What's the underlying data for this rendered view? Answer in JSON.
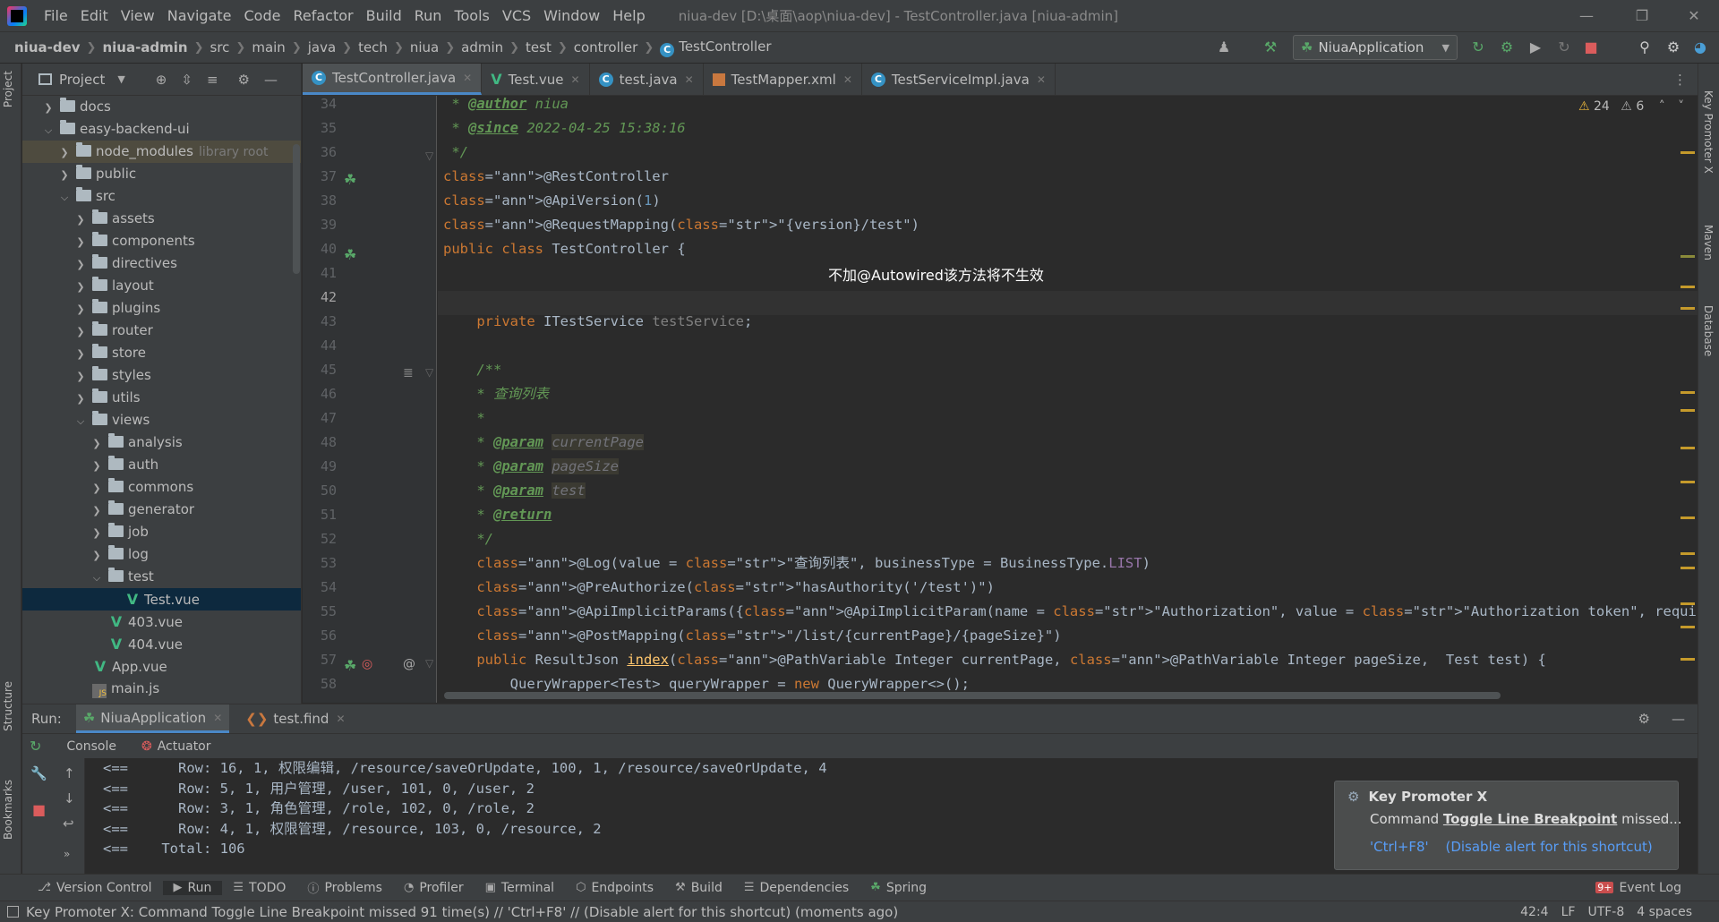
{
  "menu": [
    "File",
    "Edit",
    "View",
    "Navigate",
    "Code",
    "Refactor",
    "Build",
    "Run",
    "Tools",
    "VCS",
    "Window",
    "Help"
  ],
  "window_title": "niua-dev [D:\\桌面\\aop\\niua-dev] - TestController.java [niua-admin]",
  "breadcrumb": [
    "niua-dev",
    "niua-admin",
    "src",
    "main",
    "java",
    "tech",
    "niua",
    "admin",
    "test",
    "controller",
    "TestController"
  ],
  "run_config": "NiuaApplication",
  "project": {
    "title": "Project",
    "tree": [
      {
        "label": "docs",
        "kind": "folder",
        "depth": 1,
        "arrow": "right"
      },
      {
        "label": "easy-backend-ui",
        "kind": "folder",
        "depth": 1,
        "arrow": "down"
      },
      {
        "label": "node_modules",
        "suffix": "library root",
        "kind": "folder",
        "depth": 2,
        "arrow": "right",
        "highlight": true
      },
      {
        "label": "public",
        "kind": "folder",
        "depth": 2,
        "arrow": "right"
      },
      {
        "label": "src",
        "kind": "folder",
        "depth": 2,
        "arrow": "down"
      },
      {
        "label": "assets",
        "kind": "folder",
        "depth": 3,
        "arrow": "right"
      },
      {
        "label": "components",
        "kind": "folder",
        "depth": 3,
        "arrow": "right"
      },
      {
        "label": "directives",
        "kind": "folder",
        "depth": 3,
        "arrow": "right"
      },
      {
        "label": "layout",
        "kind": "folder",
        "depth": 3,
        "arrow": "right"
      },
      {
        "label": "plugins",
        "kind": "folder",
        "depth": 3,
        "arrow": "right"
      },
      {
        "label": "router",
        "kind": "folder",
        "depth": 3,
        "arrow": "right"
      },
      {
        "label": "store",
        "kind": "folder",
        "depth": 3,
        "arrow": "right"
      },
      {
        "label": "styles",
        "kind": "folder",
        "depth": 3,
        "arrow": "right"
      },
      {
        "label": "utils",
        "kind": "folder",
        "depth": 3,
        "arrow": "right"
      },
      {
        "label": "views",
        "kind": "folder",
        "depth": 3,
        "arrow": "down"
      },
      {
        "label": "analysis",
        "kind": "folder",
        "depth": 4,
        "arrow": "right"
      },
      {
        "label": "auth",
        "kind": "folder",
        "depth": 4,
        "arrow": "right"
      },
      {
        "label": "commons",
        "kind": "folder",
        "depth": 4,
        "arrow": "right"
      },
      {
        "label": "generator",
        "kind": "folder",
        "depth": 4,
        "arrow": "right"
      },
      {
        "label": "job",
        "kind": "folder",
        "depth": 4,
        "arrow": "right"
      },
      {
        "label": "log",
        "kind": "folder",
        "depth": 4,
        "arrow": "right"
      },
      {
        "label": "test",
        "kind": "folder",
        "depth": 4,
        "arrow": "down"
      },
      {
        "label": "Test.vue",
        "kind": "vue",
        "depth": 5,
        "selected": true
      },
      {
        "label": "403.vue",
        "kind": "vue",
        "depth": 4
      },
      {
        "label": "404.vue",
        "kind": "vue",
        "depth": 4
      },
      {
        "label": "App.vue",
        "kind": "vue",
        "depth": 3
      },
      {
        "label": "main.js",
        "kind": "js",
        "depth": 3
      }
    ]
  },
  "editor_tabs": [
    {
      "label": "TestController.java",
      "icon": "class",
      "active": true
    },
    {
      "label": "Test.vue",
      "icon": "vue"
    },
    {
      "label": "test.java",
      "icon": "class"
    },
    {
      "label": "TestMapper.xml",
      "icon": "xml"
    },
    {
      "label": "TestServiceImpl.java",
      "icon": "class"
    }
  ],
  "inspections": {
    "warnings": "24",
    "weak_warnings": "6"
  },
  "line_numbers": [
    "34",
    "35",
    "36",
    "37",
    "38",
    "39",
    "40",
    "41",
    "42",
    "43",
    "44",
    "45",
    "46",
    "47",
    "48",
    "49",
    "50",
    "51",
    "52",
    "53",
    "54",
    "55",
    "56",
    "57",
    "58"
  ],
  "code_lines": [
    " * @author niua",
    " * @since 2022-04-25 15:38:16",
    " */",
    "@RestController",
    "@ApiVersion(1)",
    "@RequestMapping(\"{version}/test\")",
    "public class TestController {",
    "",
    "",
    "    private ITestService testService;",
    "",
    "    /**",
    "    * 查询列表",
    "    *",
    "    * @param currentPage",
    "    * @param pageSize",
    "    * @param test",
    "    * @return",
    "    */",
    "    @Log(value = \"查询列表\", businessType = BusinessType.LIST)",
    "    @PreAuthorize(\"hasAuthority('/test')\")",
    "    @ApiImplicitParams({@ApiImplicitParam(name = \"Authorization\", value = \"Authorization token\", required = true, dataType = \"string\", param",
    "    @PostMapping(\"/list/{currentPage}/{pageSize}\")",
    "    public ResultJson index(@PathVariable Integer currentPage, @PathVariable Integer pageSize,  Test test) {",
    "        QueryWrapper<Test> queryWrapper = new QueryWrapper<>();"
  ],
  "overlay_note": "不加@Autowired该方法将不生效",
  "run": {
    "label": "Run:",
    "tabs": [
      "NiuaApplication",
      "test.find"
    ],
    "subtabs": [
      "Console",
      "Actuator"
    ],
    "console": [
      "<==      Row: 16, 1, 权限编辑, /resource/saveOrUpdate, 100, 1, /resource/saveOrUpdate, 4",
      "<==      Row: 5, 1, 用户管理, /user, 101, 0, /user, 2",
      "<==      Row: 3, 1, 角色管理, /role, 102, 0, /role, 2",
      "<==      Row: 4, 1, 权限管理, /resource, 103, 0, /resource, 2",
      "<==    Total: 106"
    ]
  },
  "key_promoter": {
    "title": "Key Promoter X",
    "prefix": "Command ",
    "command": "Toggle Line Breakpoint",
    "suffix": " missed...",
    "shortcut": "'Ctrl+F8'",
    "disable": "(Disable alert for this shortcut)"
  },
  "bottom_tools": [
    "Version Control",
    "Run",
    "TODO",
    "Problems",
    "Profiler",
    "Terminal",
    "Endpoints",
    "Build",
    "Dependencies",
    "Spring"
  ],
  "event_log": {
    "badge": "9+",
    "label": "Event Log"
  },
  "status": {
    "message": "Key Promoter X: Command Toggle Line Breakpoint missed 91 time(s) // 'Ctrl+F8' // (Disable alert for this shortcut) (moments ago)",
    "position": "42:4",
    "line_sep": "LF",
    "encoding": "UTF-8",
    "indent": "4 spaces"
  },
  "side_tabs": {
    "left": [
      "Project",
      "Structure",
      "Bookmarks"
    ],
    "right": [
      "Key Promoter X",
      "Maven",
      "Database"
    ]
  },
  "colors": {
    "accent": "#4a88c7",
    "bg": "#2b2b2b",
    "panel": "#3c3f41",
    "keyword": "#cc7832",
    "string": "#6a8759",
    "annotation": "#bbb529",
    "doc": "#629755"
  }
}
